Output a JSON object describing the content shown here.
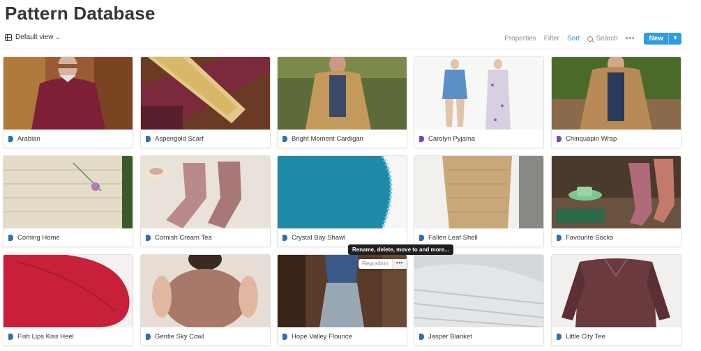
{
  "page": {
    "title": "Pattern Database"
  },
  "toolbar": {
    "view": "Default view",
    "properties": "Properties",
    "filter": "Filter",
    "sort": "Sort",
    "search": "Search",
    "more": "•••",
    "new": "New",
    "new_dropdown_icon": "chevron-down-icon"
  },
  "colors": {
    "accent": "#2f9be0",
    "sort_active": "#2a8bd4",
    "tag_blue": "#2f6fb3",
    "tag_purple": "#7a4aa8"
  },
  "cards": [
    {
      "label": "Arabian",
      "tag": "blue"
    },
    {
      "label": "Aspengold Scarf",
      "tag": "blue"
    },
    {
      "label": "Bright Moment Cardigan",
      "tag": "blue"
    },
    {
      "label": "Carolyn Pyjama",
      "tag": "purple"
    },
    {
      "label": "Chinquapin Wrap",
      "tag": "purple"
    },
    {
      "label": "Coming Home",
      "tag": "blue"
    },
    {
      "label": "Cornish Cream Tea",
      "tag": "blue"
    },
    {
      "label": "Crystal Bay Shawl",
      "tag": "blue"
    },
    {
      "label": "Fallen Leaf Shell",
      "tag": "blue"
    },
    {
      "label": "Favourite Socks",
      "tag": "blue"
    },
    {
      "label": "Fish Lips Kiss Heel",
      "tag": "blue"
    },
    {
      "label": "Gentle Sky Cowl",
      "tag": "blue"
    },
    {
      "label": "Hope Valley Flounce",
      "tag": "blue"
    },
    {
      "label": "Jasper Blanket",
      "tag": "blue"
    },
    {
      "label": "Little City Tee",
      "tag": "blue"
    }
  ],
  "hover": {
    "tooltip": "Rename, delete, move to and more...",
    "reposition": "Reposition",
    "more": "•••"
  }
}
